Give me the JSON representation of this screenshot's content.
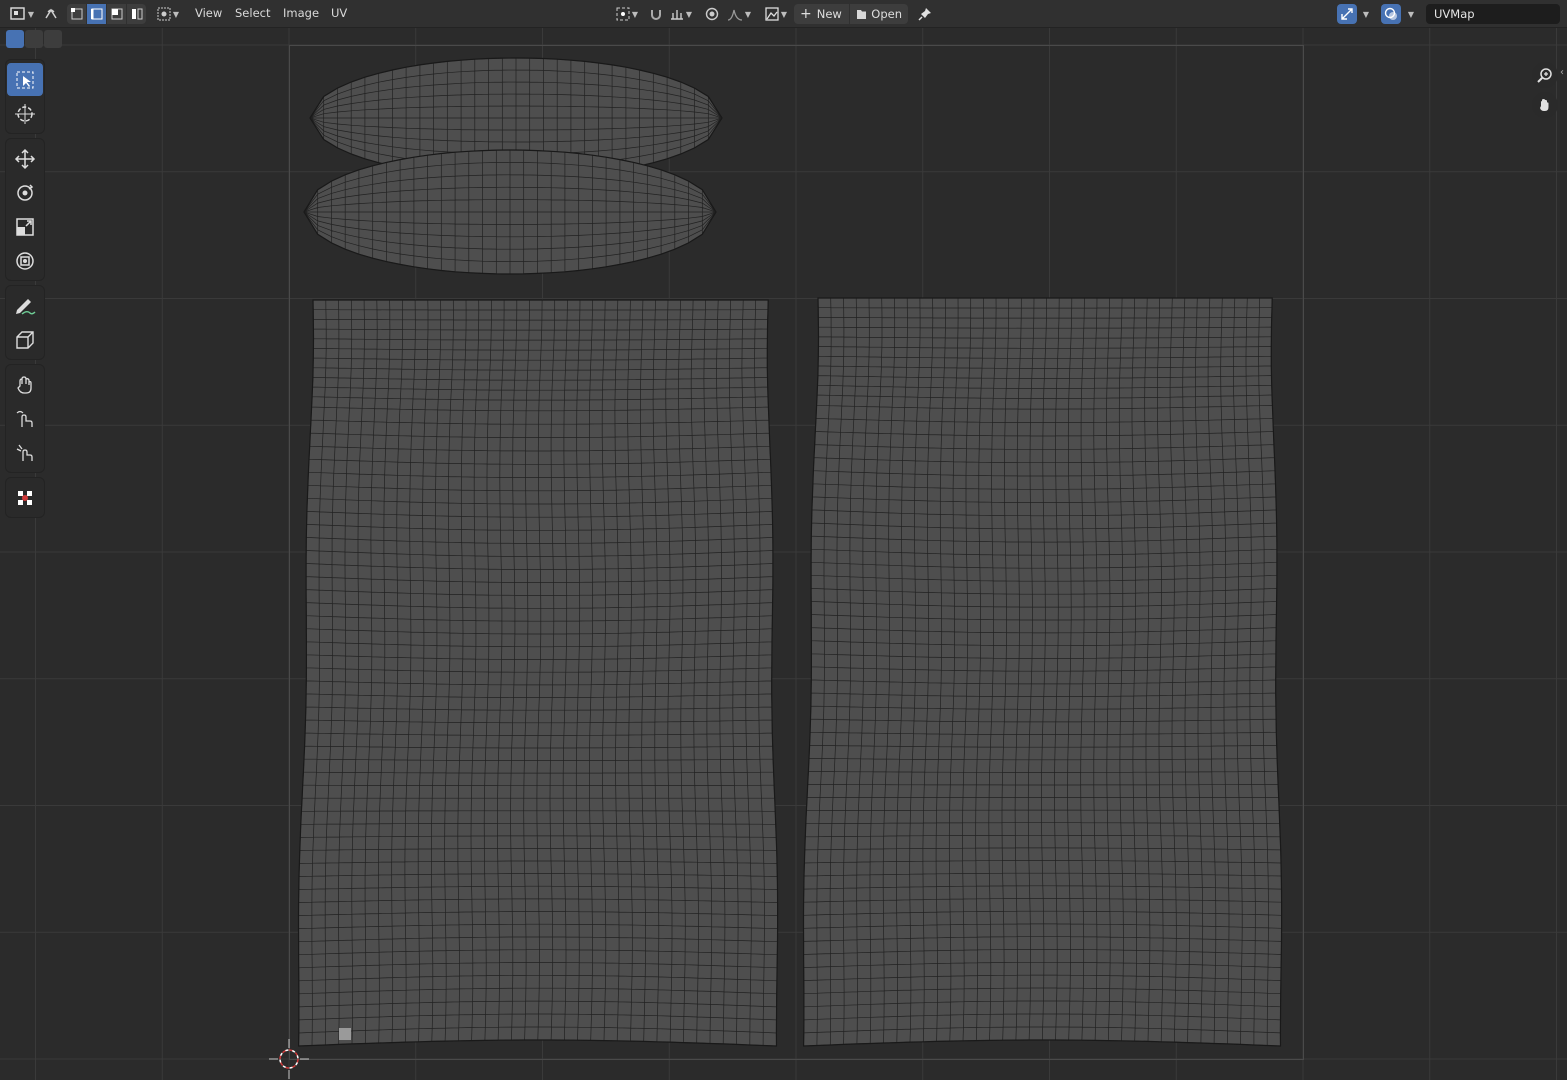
{
  "header": {
    "menus": [
      "View",
      "Select",
      "Image",
      "UV"
    ],
    "new_label": "New",
    "open_label": "Open",
    "uv_map_name": "UVMap"
  },
  "toolbar": {
    "tools": [
      {
        "name": "select-box",
        "icon": "select-box-icon",
        "active": true
      },
      {
        "name": "cursor",
        "icon": "cursor-icon"
      },
      {
        "name": "move",
        "icon": "move-icon"
      },
      {
        "name": "rotate",
        "icon": "rotate-icon"
      },
      {
        "name": "scale",
        "icon": "scale-icon"
      },
      {
        "name": "transform",
        "icon": "transform-icon"
      },
      {
        "name": "annotate",
        "icon": "annotate-icon"
      },
      {
        "name": "rip-region",
        "icon": "rip-icon"
      },
      {
        "name": "grab",
        "icon": "grab-icon"
      },
      {
        "name": "relax",
        "icon": "relax-icon"
      },
      {
        "name": "pinch",
        "icon": "pinch-icon"
      },
      {
        "name": "sample",
        "icon": "sample-icon"
      }
    ]
  },
  "colors": {
    "accent": "#4772b3",
    "header_bg": "#303030",
    "editor_bg": "#2b2b2b",
    "uv_face": "#4e4e4e",
    "uv_edge": "#1a1a1a",
    "grid_line": "#3a3a3a",
    "cursor": "#d03a3a"
  }
}
